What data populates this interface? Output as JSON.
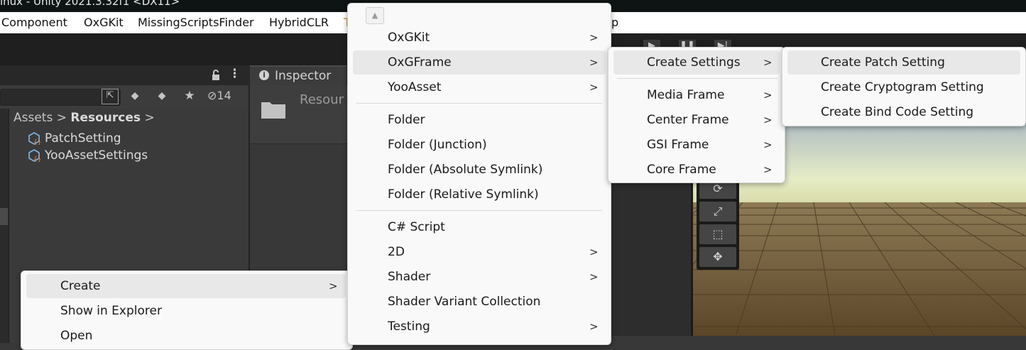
{
  "window": {
    "title": "inux - Unity 2021.3.32f1 <DX11>"
  },
  "menubar": {
    "items": [
      "Component",
      "OxGKit",
      "MissingScriptsFinder",
      "HybridCLR",
      "T",
      "p"
    ]
  },
  "project": {
    "hidden_count": "14",
    "breadcrumb": {
      "root": "Assets",
      "sep": ">",
      "current": "Resources",
      "trail": ">"
    },
    "assets": [
      "PatchSetting",
      "YooAssetSettings"
    ]
  },
  "inspector": {
    "tab_label": "Inspector",
    "folder_name": "Resour"
  },
  "context_menu": {
    "items": [
      "Create",
      "Show in Explorer",
      "Open"
    ]
  },
  "create_menu": {
    "scroll_up": "▲",
    "items": [
      "OxGKit",
      "OxGFrame",
      "YooAsset",
      "Folder",
      "Folder (Junction)",
      "Folder (Absolute Symlink)",
      "Folder (Relative Symlink)",
      "C# Script",
      "2D",
      "Shader",
      "Shader Variant Collection",
      "Testing"
    ]
  },
  "oxgframe_menu": {
    "items": [
      "Create Settings",
      "Media Frame",
      "Center Frame",
      "GSI Frame",
      "Core Frame"
    ]
  },
  "settings_menu": {
    "items": [
      "Create Patch Setting",
      "Create Cryptogram Setting",
      "Create Bind Code Setting"
    ]
  },
  "colors": {
    "menu_bg": "#f9f9f9",
    "menu_highlight": "#e8e8e8",
    "editor_dark": "#383838",
    "title_bg": "#0e1414"
  }
}
